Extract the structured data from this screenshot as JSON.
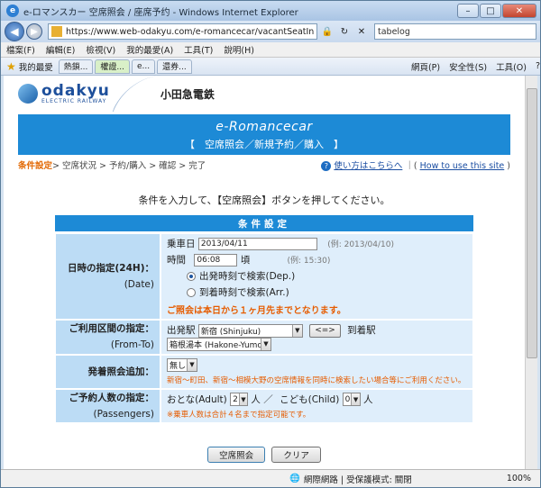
{
  "window": {
    "title": "e-ロマンスカー  空席照会 / 座席予约 - Windows Internet Explorer"
  },
  "address": {
    "url": "https://www.web-odakyu.com/e-romancecar/vacantSeatIn",
    "search_text": "tabelog"
  },
  "menu": {
    "items": [
      "檔案(F)",
      "編輯(E)",
      "檢視(V)",
      "我的最愛(A)",
      "工具(T)",
      "說明(H)"
    ]
  },
  "favorites": {
    "label": "我的最愛",
    "tabs": [
      "熱鎖...",
      "權證...",
      "e...",
      "還券..."
    ],
    "tools": [
      "網頁(P)",
      "安全性(S)",
      "工具(O)"
    ]
  },
  "header": {
    "logo_main": "odakyu",
    "logo_sub": "ELECTRIC RAILWAY",
    "company": "小田急電鉄"
  },
  "banner": {
    "brand": "e-Romancecar",
    "subtitle": "【　空席照会／新規予約／購入　】"
  },
  "breadcrumb": {
    "current": "条件設定",
    "rest": " > 空席状況 > 予約/購入 > 確認 > 完了",
    "help_ja": "使い方はこちらへ",
    "help_en": "How to use this site"
  },
  "instruction": "条件を入力して、【空席照会】ボタンを押してください。",
  "form": {
    "header": "条件設定",
    "date_label_ja": "日時の指定(24H)：",
    "date_label_en": "(Date)",
    "boarding_date_label": "乗車日",
    "boarding_date_value": "2013/04/11",
    "date_example": "(例: 2013/04/10)",
    "time_label": "時間",
    "time_value": "06:08",
    "time_suffix": "頃",
    "time_example": "(例: 15:30)",
    "radio_dep": "出発時刻で検索(Dep.)",
    "radio_arr": "到着時刻で検索(Arr.)",
    "date_warning": "ご照会は本日から１ヶ月先までとなります。",
    "route_label_ja": "ご利用区間の指定：",
    "route_label_en": "(From-To)",
    "from_label": "出発駅",
    "from_value": "新宿 (Shinjuku)",
    "swap_label": "<=>",
    "to_label": "到着駅",
    "to_value": "箱根湯本 (Hakone-Yumo",
    "extra_label": "発着照会追加：",
    "extra_value": "無し",
    "extra_note": "新宿～町田、新宿～相模大野の空席情報を同時に検索したい場合等にご利用ください。",
    "pax_label_ja": "ご予約人数の指定：",
    "pax_label_en": "(Passengers)",
    "adult_label": "おとな(Adult)",
    "adult_value": "2",
    "adult_unit": "人 ／",
    "child_label": "こども(Child)",
    "child_value": "0",
    "child_unit": "人",
    "pax_note": "※乗車人数は合計４名まで指定可能です。"
  },
  "buttons": {
    "search": "空席照会",
    "clear": "クリア"
  },
  "status": {
    "zone": "網際網路 | 受保護模式: 關閉",
    "zoom": "100%"
  }
}
